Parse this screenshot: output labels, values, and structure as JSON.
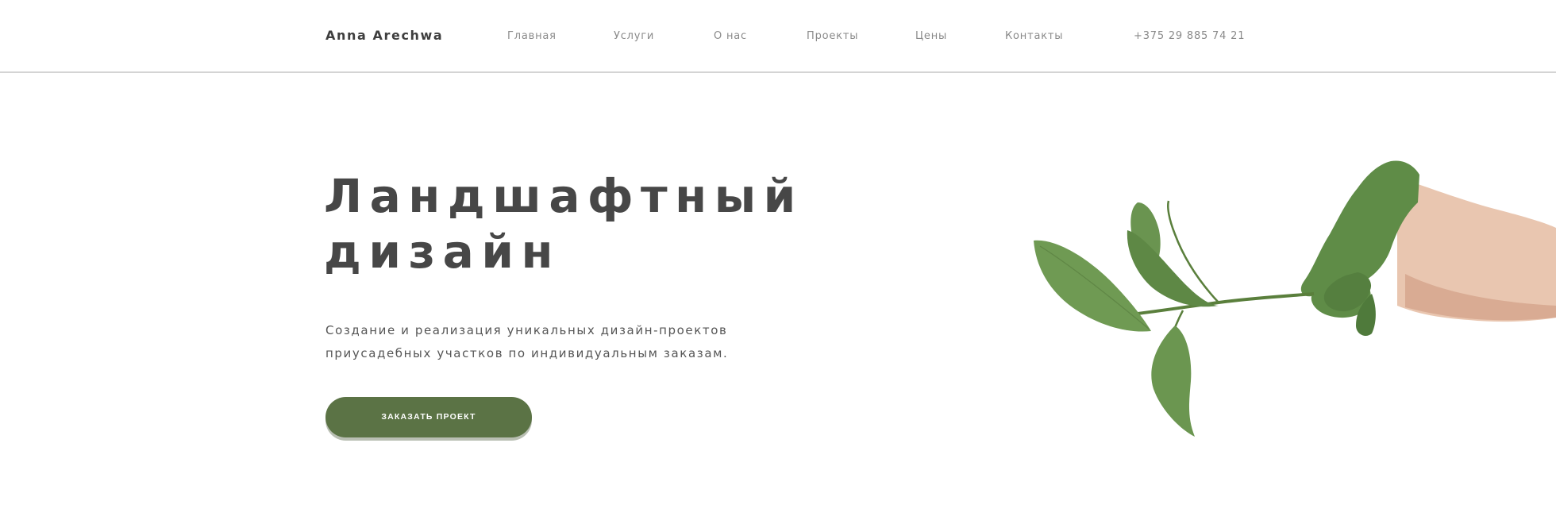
{
  "header": {
    "logo": "Anna Arechwa",
    "nav": [
      {
        "label": "Главная"
      },
      {
        "label": "Услуги"
      },
      {
        "label": "О нас"
      },
      {
        "label": "Проекты"
      },
      {
        "label": "Цены"
      },
      {
        "label": "Контакты"
      }
    ],
    "phone": "+375 29 885 74 21"
  },
  "hero": {
    "title_line1": "Ландшафтный",
    "title_line2": "дизайн",
    "desc_line1": "Создание и реализация уникальных дизайн-проектов",
    "desc_line2": "приусадебных участков по индивидуальным заказам.",
    "cta_label": "ЗАКАЗАТЬ ПРОЕКТ"
  },
  "colors": {
    "accent": "#5b7345",
    "title": "#474747",
    "leaf": "#6a9150",
    "skin": "#e8c4ae"
  }
}
